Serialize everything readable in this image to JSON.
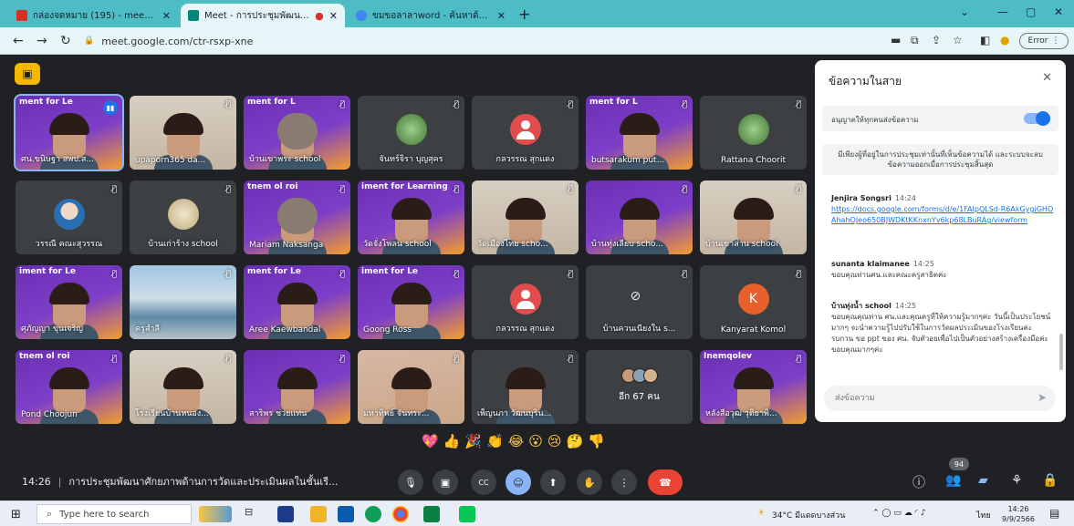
{
  "browser": {
    "tabs": [
      {
        "label": "กล่องจดหมาย (195) - meeting1@...",
        "favicon_color": "#d93025"
      },
      {
        "label": "Meet - การประชุมพัฒนาศักยภา...",
        "favicon_color": "#00897b"
      },
      {
        "label": "ขมขอลาลาword - ค้นหาด้วย Googl...",
        "favicon_color": "#4285f4"
      }
    ],
    "new_tab": "+",
    "url": "meet.google.com/ctr-rsxp-xne",
    "error_label": "Error"
  },
  "meet": {
    "logo_icon": "presentation-icon",
    "participants": [
      {
        "name": "ศน.ขนิษฐา สพป.ส...",
        "bg": "purple",
        "banner": "ment for Le",
        "kind": "face",
        "speaking": true
      },
      {
        "name": "upaporn365 da...",
        "bg": "room",
        "kind": "face"
      },
      {
        "name": "บ้านเขาพระ school",
        "bg": "purple",
        "banner": "ment for L",
        "kind": "hijab"
      },
      {
        "name": "จันทร์จิรา บุญสุคร",
        "bg": "gray",
        "kind": "avatar",
        "avatar": "av-photo"
      },
      {
        "name": "กลวรรณ สุกแดง",
        "bg": "gray",
        "kind": "avatar",
        "avatar": "av-red"
      },
      {
        "name": "butsarakum put...",
        "bg": "purple",
        "banner": "ment for L",
        "kind": "face"
      },
      {
        "name": "Rattana Choorit",
        "bg": "gray",
        "kind": "avatar",
        "avatar": "av-photo"
      },
      {
        "name": "วรรณี คณะสุวรรณ",
        "bg": "gray",
        "kind": "avatar",
        "avatar": "av-person"
      },
      {
        "name": "บ้านเก่าร้าง school",
        "bg": "gray",
        "kind": "avatar",
        "avatar": "av-seal"
      },
      {
        "name": "Mariam Naksanga",
        "bg": "purple",
        "banner": "tnem ol roi",
        "kind": "hijab"
      },
      {
        "name": "วัดจั่งโพลน school",
        "bg": "purple",
        "banner": "iment for Learning",
        "kind": "face"
      },
      {
        "name": "วัดเมืองไทย scho...",
        "bg": "room",
        "kind": "face"
      },
      {
        "name": "บ้านทุ่งเลียบ scho...",
        "bg": "purple",
        "banner": "",
        "kind": "face"
      },
      {
        "name": "บ้านเขาส่าน school",
        "bg": "room",
        "kind": "face"
      },
      {
        "name": "ศุภัญญา ขุนเจริญ",
        "bg": "purple",
        "banner": "iment for Le",
        "kind": "face"
      },
      {
        "name": "ครูสำลี",
        "bg": "sea",
        "kind": "none"
      },
      {
        "name": "Aree Kaewbandal",
        "bg": "purple",
        "banner": "ment for Le",
        "kind": "face"
      },
      {
        "name": "Goong Ross",
        "bg": "purple",
        "banner": "iment for Le",
        "kind": "face"
      },
      {
        "name": "กลวรรณ สุกแดง",
        "bg": "gray",
        "kind": "avatar",
        "avatar": "av-red"
      },
      {
        "name": "บ้านควนเนียงใน s...",
        "bg": "gray",
        "kind": "camoff"
      },
      {
        "name": "Kanyarat Komol",
        "bg": "gray",
        "kind": "avatar",
        "avatar": "av-orange",
        "letter": "K"
      },
      {
        "name": "Pond Choojun",
        "bg": "purple",
        "banner": "tnem ol roi",
        "kind": "face"
      },
      {
        "name": "โรงเรียนบ้านหนอง...",
        "bg": "room",
        "kind": "face"
      },
      {
        "name": "สาริพร ช่วยแท่น",
        "bg": "purple",
        "banner": "",
        "kind": "face"
      },
      {
        "name": "มหาทิพย์ จันทระ...",
        "bg": "pic",
        "kind": "face"
      },
      {
        "name": "เพ็ญนภา วัฒนบุริน...",
        "bg": "gray",
        "kind": "face"
      },
      {
        "name": "",
        "bg": "gray",
        "kind": "more",
        "more_label": "อีก 67 คน"
      },
      {
        "name": "หลังสือวุฒ วุติยาพิ...",
        "bg": "purple",
        "banner": "Inemqolev",
        "kind": "face"
      }
    ],
    "reactions": [
      "💖",
      "👍",
      "🎉",
      "👏",
      "😂",
      "😮",
      "😢",
      "🤔",
      "👎"
    ],
    "meeting_time": "14:26",
    "meeting_title": "การประชุมพัฒนาศักยภาพด้านการวัดและประเมินผลในชั้นเรี...",
    "participant_count": "94",
    "controls": {
      "mic": "🎙",
      "camera": "▣",
      "captions": "CC",
      "reactions": "☺",
      "present": "⬆",
      "raise_hand": "✋",
      "more": "⋮",
      "end_call": "☎"
    }
  },
  "chat": {
    "title": "ข้อความในสาย",
    "close": "✕",
    "allow_label": "อนุญาตให้ทุกคนส่งข้อความ",
    "allow_on": true,
    "info": "มีเพียงผู้ที่อยู่ในการประชุมเท่านั้นที่เห็นข้อความได้ และระบบจะลบข้อความออกเมื่อการประชุมสิ้นสุด",
    "messages": [
      {
        "sender": "Jenjira Songsri",
        "time": "14:24",
        "text": "",
        "link": "https://docs.google.com/forms/d/e/1FAIpQLSd-R6AkGygiGHOAhahOJeo650BJWDKtKKnxnYv6kp68LBuRAg/viewform"
      },
      {
        "sender": "sunanta klaimanee",
        "time": "14:25",
        "text": "ขอบคุณท่านศน.และคณะครูสาธิตค่ะ",
        "link": ""
      },
      {
        "sender": "บ้านทุ่งน้ำ school",
        "time": "14:25",
        "text": "ขอบคุณคุณท่าน ศน.และคุณครูที่ให้ความรู้มากๆค่ะ วันนี้เป็นประโยชน์มากๆ จะนำความรู้ไปปรับใช้ในการวัดผลประเมินของโรงเรียนค่ะ รบกวน ขอ ppt ของ ศน. จับตัวอยเพื่อไปเป็นตัวอย่างสร้างเครื่องมือค่ะ ขอบคุณมากๆค่ะ",
        "link": ""
      }
    ],
    "input_placeholder": "ส่งข้อความ",
    "send_icon": "send-icon"
  },
  "taskbar": {
    "search_placeholder": "Type here to search",
    "weather": "34°C มีแดดบางส่วน",
    "lang": "ไทย",
    "time": "14:26",
    "date": "9/9/2566"
  }
}
